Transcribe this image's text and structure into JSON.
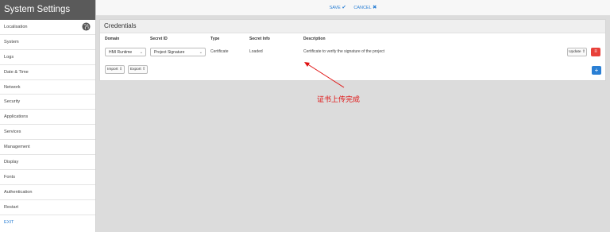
{
  "sidebar": {
    "title": "System Settings",
    "items": [
      {
        "label": "Localisation",
        "icon": "globe-icon"
      },
      {
        "label": "System"
      },
      {
        "label": "Logs"
      },
      {
        "label": "Date & Time"
      },
      {
        "label": "Network"
      },
      {
        "label": "Security"
      },
      {
        "label": "Applications"
      },
      {
        "label": "Services"
      },
      {
        "label": "Management"
      },
      {
        "label": "Display"
      },
      {
        "label": "Fonts"
      },
      {
        "label": "Authentication"
      },
      {
        "label": "Restart"
      }
    ],
    "exit_label": "EXIT"
  },
  "toolbar": {
    "save_label": "SAVE",
    "save_icon": "✔",
    "cancel_label": "CANCEL",
    "cancel_icon": "✖"
  },
  "credentials": {
    "title": "Credentials",
    "columns": [
      "Domain",
      "Secret ID",
      "Type",
      "Secret Info",
      "Description"
    ],
    "rows": [
      {
        "domain": "HMI Runtime",
        "secret_id": "Project Signature",
        "type": "Certificate",
        "secret_info": "Loaded",
        "description": "Certificate to verify the signature of the project"
      }
    ],
    "update_label": "Update",
    "import_label": "Import",
    "export_label": "Export",
    "delete_icon": "≡",
    "add_icon": "+"
  },
  "annotation": {
    "text": "证书上传完成",
    "color": "#e01010"
  },
  "colors": {
    "accent": "#2a7fd4",
    "danger": "#e8413a",
    "sidebar_header": "#5a5a5a"
  }
}
